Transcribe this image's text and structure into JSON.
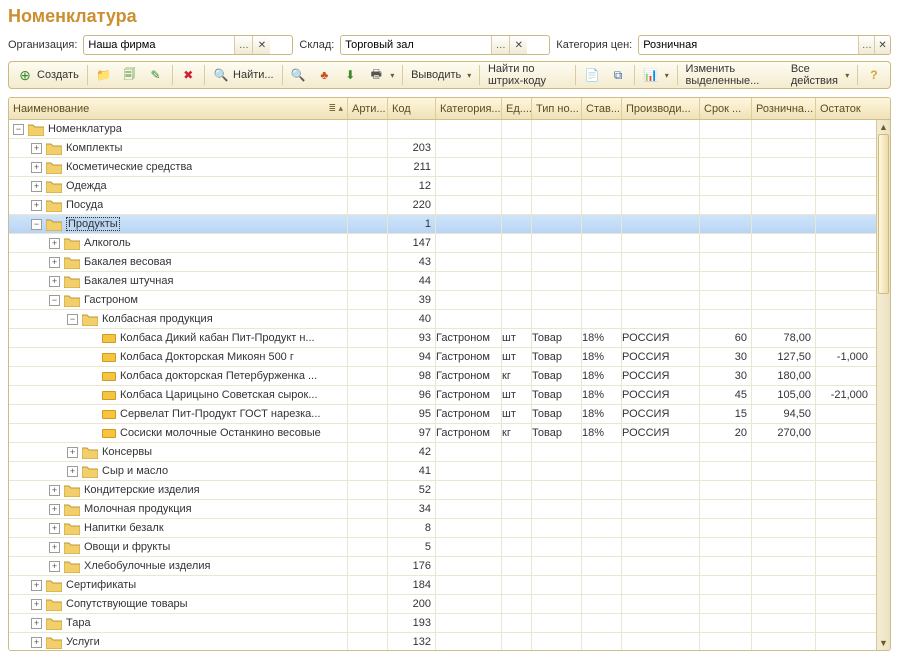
{
  "title": "Номенклатура",
  "filters": {
    "org_label": "Организация:",
    "org_value": "Наша фирма",
    "wh_label": "Склад:",
    "wh_value": "Торговый зал",
    "pc_label": "Категория цен:",
    "pc_value": "Розничная"
  },
  "toolbar": {
    "create": "Создать",
    "find": "Найти...",
    "output": "Выводить",
    "find_barcode": "Найти по штрих-коду",
    "change_selected": "Изменить выделенные...",
    "all_actions": "Все действия"
  },
  "columns": {
    "name": "Наименование",
    "art": "Арти...",
    "code": "Код",
    "cat": "Категория...",
    "unit": "Ед....",
    "type": "Тип но...",
    "rate": "Став...",
    "prod": "Производи...",
    "shelf": "Срок ...",
    "price": "Рознична...",
    "rem": "Остаток"
  },
  "rows": [
    {
      "lvl": 0,
      "kind": "folder",
      "exp": "minus",
      "name": "Номенклатура"
    },
    {
      "lvl": 1,
      "kind": "folder",
      "exp": "plus",
      "name": "Комплекты",
      "code": "203"
    },
    {
      "lvl": 1,
      "kind": "folder",
      "exp": "plus",
      "name": "Косметические средства",
      "code": "211"
    },
    {
      "lvl": 1,
      "kind": "folder",
      "exp": "plus",
      "name": "Одежда",
      "code": "12"
    },
    {
      "lvl": 1,
      "kind": "folder",
      "exp": "plus",
      "name": "Посуда",
      "code": "220"
    },
    {
      "lvl": 1,
      "kind": "folder",
      "exp": "minus",
      "name": "Продукты",
      "code": "1",
      "selected": true
    },
    {
      "lvl": 2,
      "kind": "folder",
      "exp": "plus",
      "name": "Алкоголь",
      "code": "147"
    },
    {
      "lvl": 2,
      "kind": "folder",
      "exp": "plus",
      "name": "Бакалея весовая",
      "code": "43"
    },
    {
      "lvl": 2,
      "kind": "folder",
      "exp": "plus",
      "name": "Бакалея штучная",
      "code": "44"
    },
    {
      "lvl": 2,
      "kind": "folder",
      "exp": "minus",
      "name": "Гастроном",
      "code": "39"
    },
    {
      "lvl": 3,
      "kind": "folder",
      "exp": "minus",
      "name": "Колбасная продукция",
      "code": "40"
    },
    {
      "lvl": 4,
      "kind": "item",
      "name": "Колбаса Дикий кабан Пит-Продукт н...",
      "code": "93",
      "cat": "Гастроном",
      "unit": "шт",
      "type": "Товар",
      "rate": "18%",
      "prod": "РОССИЯ",
      "shelf": "60",
      "price": "78,00"
    },
    {
      "lvl": 4,
      "kind": "item",
      "name": "Колбаса Докторская Микоян 500 г",
      "code": "94",
      "cat": "Гастроном",
      "unit": "шт",
      "type": "Товар",
      "rate": "18%",
      "prod": "РОССИЯ",
      "shelf": "30",
      "price": "127,50",
      "rem": "-1,000"
    },
    {
      "lvl": 4,
      "kind": "item",
      "name": "Колбаса докторская Петербурженка ...",
      "code": "98",
      "cat": "Гастроном",
      "unit": "кг",
      "type": "Товар",
      "rate": "18%",
      "prod": "РОССИЯ",
      "shelf": "30",
      "price": "180,00"
    },
    {
      "lvl": 4,
      "kind": "item",
      "name": "Колбаса Царицыно Советская сырок...",
      "code": "96",
      "cat": "Гастроном",
      "unit": "шт",
      "type": "Товар",
      "rate": "18%",
      "prod": "РОССИЯ",
      "shelf": "45",
      "price": "105,00",
      "rem": "-21,000"
    },
    {
      "lvl": 4,
      "kind": "item",
      "name": "Сервелат Пит-Продукт ГОСТ нарезка...",
      "code": "95",
      "cat": "Гастроном",
      "unit": "шт",
      "type": "Товар",
      "rate": "18%",
      "prod": "РОССИЯ",
      "shelf": "15",
      "price": "94,50"
    },
    {
      "lvl": 4,
      "kind": "item",
      "name": "Сосиски молочные Останкино весовые",
      "code": "97",
      "cat": "Гастроном",
      "unit": "кг",
      "type": "Товар",
      "rate": "18%",
      "prod": "РОССИЯ",
      "shelf": "20",
      "price": "270,00"
    },
    {
      "lvl": 3,
      "kind": "folder",
      "exp": "plus",
      "name": "Консервы",
      "code": "42"
    },
    {
      "lvl": 3,
      "kind": "folder",
      "exp": "plus",
      "name": "Сыр и масло",
      "code": "41"
    },
    {
      "lvl": 2,
      "kind": "folder",
      "exp": "plus",
      "name": "Кондитерские изделия",
      "code": "52"
    },
    {
      "lvl": 2,
      "kind": "folder",
      "exp": "plus",
      "name": "Молочная продукция",
      "code": "34"
    },
    {
      "lvl": 2,
      "kind": "folder",
      "exp": "plus",
      "name": "Напитки безалк",
      "code": "8"
    },
    {
      "lvl": 2,
      "kind": "folder",
      "exp": "plus",
      "name": "Овощи и фрукты",
      "code": "5"
    },
    {
      "lvl": 2,
      "kind": "folder",
      "exp": "plus",
      "name": "Хлебобулочные изделия",
      "code": "176"
    },
    {
      "lvl": 1,
      "kind": "folder",
      "exp": "plus",
      "name": "Сертификаты",
      "code": "184"
    },
    {
      "lvl": 1,
      "kind": "folder",
      "exp": "plus",
      "name": "Сопутствующие товары",
      "code": "200"
    },
    {
      "lvl": 1,
      "kind": "folder",
      "exp": "plus",
      "name": "Тара",
      "code": "193"
    },
    {
      "lvl": 1,
      "kind": "folder",
      "exp": "plus",
      "name": "Услуги",
      "code": "132"
    }
  ]
}
